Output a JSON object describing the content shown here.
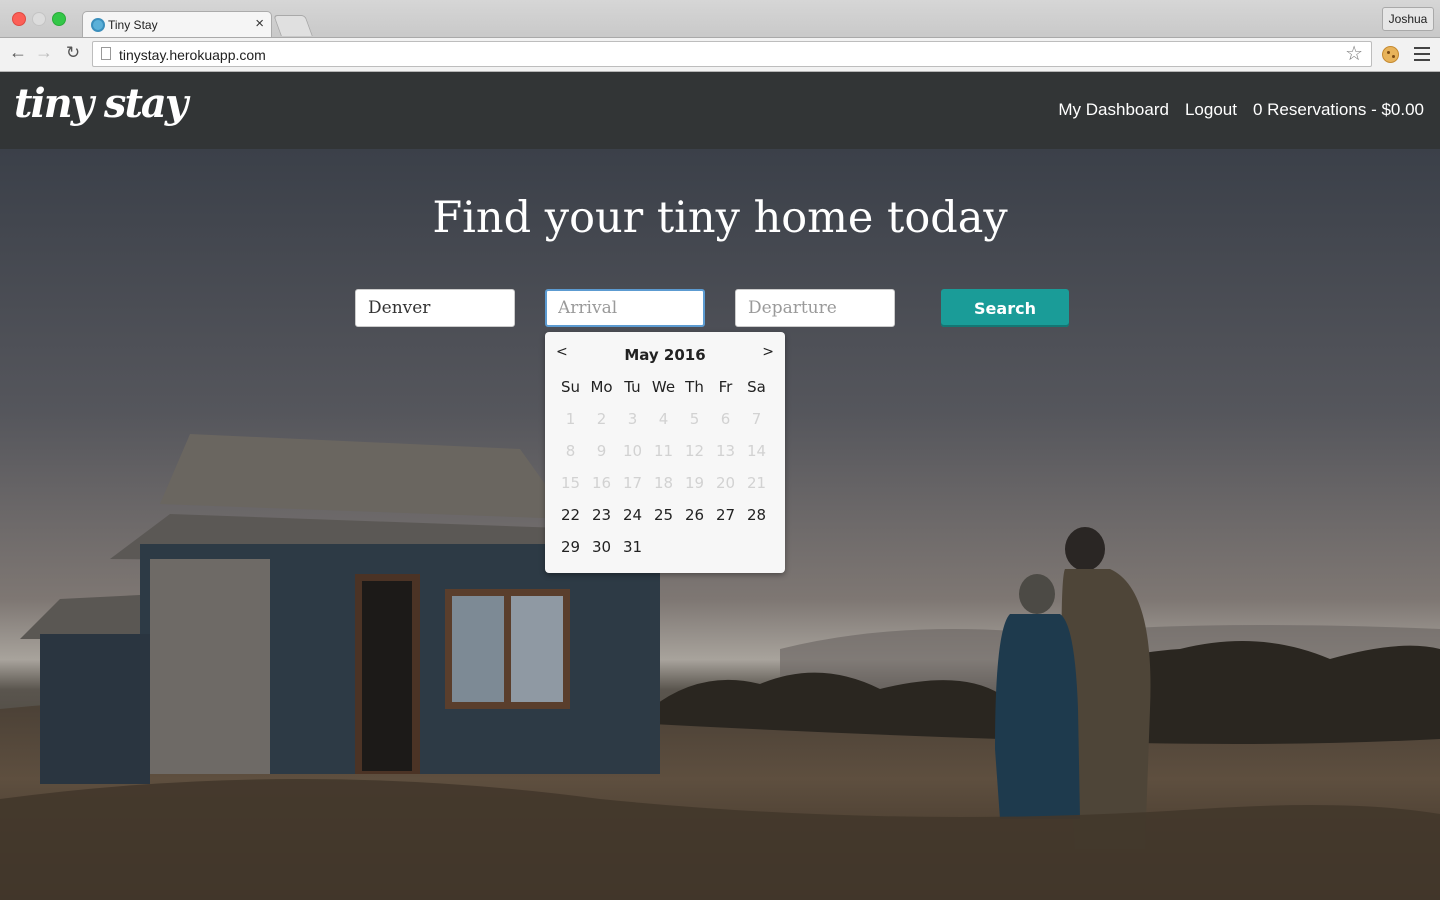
{
  "browser": {
    "tab_title": "Tiny Stay",
    "tab_close": "×",
    "url": "tinystay.herokuapp.com",
    "profile": "Joshua",
    "star": "☆"
  },
  "header": {
    "logo": "tiny stay",
    "nav": {
      "dashboard": "My Dashboard",
      "logout": "Logout",
      "reservations": "0 Reservations - $0.00"
    }
  },
  "hero": {
    "headline": "Find your tiny home today",
    "search": {
      "city_value": "Denver",
      "arrival_placeholder": "Arrival",
      "departure_placeholder": "Departure",
      "button": "Search"
    }
  },
  "datepicker": {
    "prev": "<",
    "next": ">",
    "month": "May 2016",
    "weekdays": [
      "Su",
      "Mo",
      "Tu",
      "We",
      "Th",
      "Fr",
      "Sa"
    ],
    "days": [
      {
        "d": "1",
        "off": true
      },
      {
        "d": "2",
        "off": true
      },
      {
        "d": "3",
        "off": true
      },
      {
        "d": "4",
        "off": true
      },
      {
        "d": "5",
        "off": true
      },
      {
        "d": "6",
        "off": true
      },
      {
        "d": "7",
        "off": true
      },
      {
        "d": "8",
        "off": true
      },
      {
        "d": "9",
        "off": true
      },
      {
        "d": "10",
        "off": true
      },
      {
        "d": "11",
        "off": true
      },
      {
        "d": "12",
        "off": true
      },
      {
        "d": "13",
        "off": true
      },
      {
        "d": "14",
        "off": true
      },
      {
        "d": "15",
        "off": true
      },
      {
        "d": "16",
        "off": true
      },
      {
        "d": "17",
        "off": true
      },
      {
        "d": "18",
        "off": true
      },
      {
        "d": "19",
        "off": true
      },
      {
        "d": "20",
        "off": true
      },
      {
        "d": "21",
        "off": true
      },
      {
        "d": "22",
        "off": false
      },
      {
        "d": "23",
        "off": false
      },
      {
        "d": "24",
        "off": false
      },
      {
        "d": "25",
        "off": false
      },
      {
        "d": "26",
        "off": false
      },
      {
        "d": "27",
        "off": false
      },
      {
        "d": "28",
        "off": false
      },
      {
        "d": "29",
        "off": false
      },
      {
        "d": "30",
        "off": false
      },
      {
        "d": "31",
        "off": false
      }
    ]
  },
  "colors": {
    "header_bg": "#323536",
    "search_button": "#1a9c98",
    "focus_border": "#5c9bd1"
  }
}
